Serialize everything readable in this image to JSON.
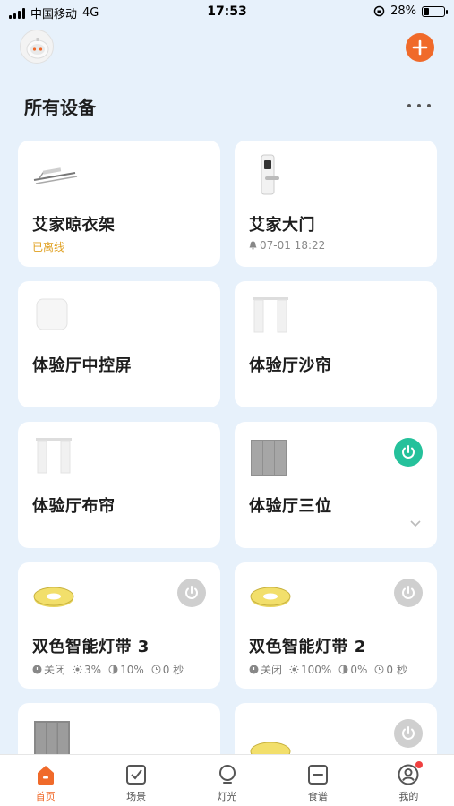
{
  "status_bar": {
    "carrier": "中国移动",
    "network": "4G",
    "time": "17:53",
    "battery": "28%",
    "battery_level": 0.28
  },
  "header": {
    "title": "所有设备",
    "add_icon": "plus-icon",
    "more_icon": "more-dots-icon",
    "accent_color": "#f06a2a"
  },
  "devices": [
    {
      "name": "艾家晾衣架",
      "status": "已离线"
    },
    {
      "name": "艾家大门",
      "status": "07-01 18:22"
    },
    {
      "name": "体验厅中控屏"
    },
    {
      "name": "体验厅沙帘"
    },
    {
      "name": "体验厅布帘"
    },
    {
      "name": "体验厅三位"
    },
    {
      "name": "双色智能灯带 3",
      "power": "关闭",
      "brightness": "3%",
      "temp": "10%",
      "timer": "0 秒"
    },
    {
      "name": "双色智能灯带 2",
      "power": "关闭",
      "brightness": "100%",
      "temp": "0%",
      "timer": "0 秒"
    },
    {
      "name": ""
    },
    {
      "name": ""
    }
  ],
  "tabs": [
    {
      "label": "首页",
      "icon": "home-icon"
    },
    {
      "label": "场景",
      "icon": "scene-check-icon"
    },
    {
      "label": "灯光",
      "icon": "bulb-icon"
    },
    {
      "label": "食谱",
      "icon": "recipe-icon"
    },
    {
      "label": "我的",
      "icon": "profile-icon"
    }
  ]
}
